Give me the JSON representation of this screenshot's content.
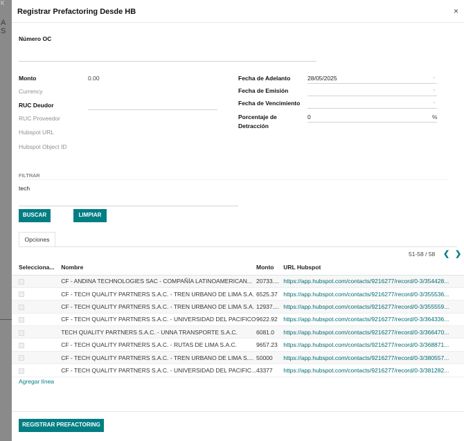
{
  "background": {
    "side_text": "A S",
    "side_top_text": "K"
  },
  "modal": {
    "title": "Registrar Prefactoring Desde HB",
    "close_symbol": "×"
  },
  "form": {
    "numero_oc": {
      "label": "Número OC",
      "value": ""
    },
    "monto": {
      "label": "Monto",
      "value": "0.00"
    },
    "currency": {
      "label": "Currency",
      "value": ""
    },
    "ruc_deudor": {
      "label": "RUC Deudor",
      "value": ""
    },
    "ruc_proveedor": {
      "label": "RUC Proveedor",
      "value": ""
    },
    "hubspot_url": {
      "label": "Hubspot URL",
      "value": ""
    },
    "hubspot_object_id": {
      "label": "Hubspot Object ID",
      "value": ""
    },
    "fecha_adelanto": {
      "label": "Fecha de Adelanto",
      "value": "28/05/2025"
    },
    "fecha_emision": {
      "label": "Fecha de Emisión",
      "value": ""
    },
    "fecha_vencimiento": {
      "label": "Fecha de Vencimiento",
      "value": ""
    },
    "porcentaje_detraccion": {
      "label_line1": "Porcentaje de",
      "label_line2": "Detracción",
      "value": "0",
      "unit": "%"
    },
    "caret": "⌄"
  },
  "filter": {
    "label": "FILTRAR",
    "value": "tech",
    "buscar_label": "BUSCAR",
    "limpiar_label": "LIMPIAR"
  },
  "tabs": [
    {
      "label": "Opciones",
      "active": true
    }
  ],
  "pager": {
    "text": "51-58 / 58",
    "prev": "❮",
    "next": "❯"
  },
  "table": {
    "columns": [
      "Selecciona...",
      "Nombre",
      "Monto",
      "URL Hubspot"
    ],
    "rows": [
      {
        "nombre": "CF - ANDINA TECHNOLOGIES SAC - COMPAÑÍA LATINOAMERICAN...",
        "monto": "20733....",
        "url": "https://app.hubspot.com/contacts/9216277/record/0-3/354428..."
      },
      {
        "nombre": "CF - TECH QUALITY PARTNERS S.A.C. - TREN URBANO DE LIMA S.A.",
        "monto": "6525.37",
        "url": "https://app.hubspot.com/contacts/9216277/record/0-3/355536..."
      },
      {
        "nombre": "CF - TECH QUALITY PARTNERS S.A.C. - TREN URBANO DE LIMA S.A.",
        "monto": "12937....",
        "url": "https://app.hubspot.com/contacts/9216277/record/0-3/355559..."
      },
      {
        "nombre": "CF - TECH QUALITY PARTNERS S.A.C. - UNIVERSIDAD DEL PACIFICO",
        "monto": "9622.92",
        "url": "https://app.hubspot.com/contacts/9216277/record/0-3/364336..."
      },
      {
        "nombre": "TECH QUALITY PARTNERS S.A.C. - UNNA TRANSPORTE S.A.C.",
        "monto": "6081.0",
        "url": "https://app.hubspot.com/contacts/9216277/record/0-3/366470..."
      },
      {
        "nombre": "CF - TECH QUALITY PARTNERS S.A.C. - RUTAS DE LIMA S.A.C.",
        "monto": "9657.23",
        "url": "https://app.hubspot.com/contacts/9216277/record/0-3/368871..."
      },
      {
        "nombre": "CF - TECH QUALITY PARTNERS S.A.C. - TREN URBANO DE LIMA S....",
        "monto": "50000",
        "url": "https://app.hubspot.com/contacts/9216277/record/0-3/380557..."
      },
      {
        "nombre": "CF - TECH QUALITY PARTNERS S.A.C. - UNIVERSIDAD DEL PACIFIC...",
        "monto": "43377",
        "url": "https://app.hubspot.com/contacts/9216277/record/0-3/381282..."
      }
    ],
    "add_line_label": "Agregar línea"
  },
  "footer": {
    "submit_label": "REGISTRAR PREFACTORING"
  },
  "colors": {
    "primary": "#017e84",
    "brand": "#714B67"
  }
}
